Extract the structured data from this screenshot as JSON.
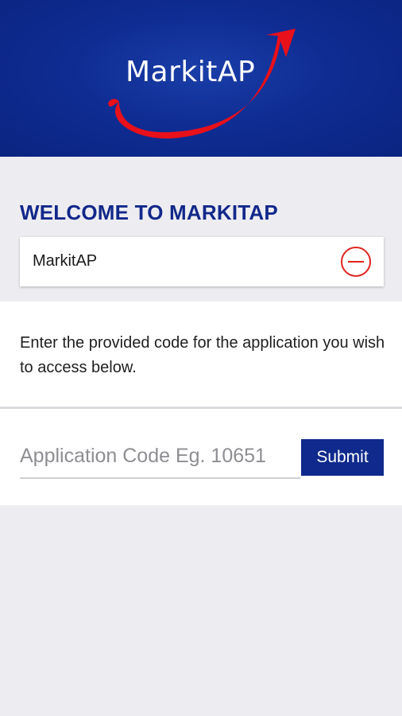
{
  "header": {
    "logo_text": "MarkitAP",
    "colors": {
      "background": "#0f2c93",
      "swoosh": "#e8101a"
    }
  },
  "welcome": {
    "title": "WELCOME TO MARKITAP"
  },
  "selected_app": {
    "name": "MarkitAP",
    "remove_icon": "minus-circle-icon",
    "remove_color": "#e0241f"
  },
  "info": {
    "text": "Enter the provided code for the application you wish to access below."
  },
  "code_form": {
    "placeholder": "Application Code Eg. 10651",
    "value": "",
    "submit_label": "Submit",
    "submit_color": "#0f2a8c"
  }
}
